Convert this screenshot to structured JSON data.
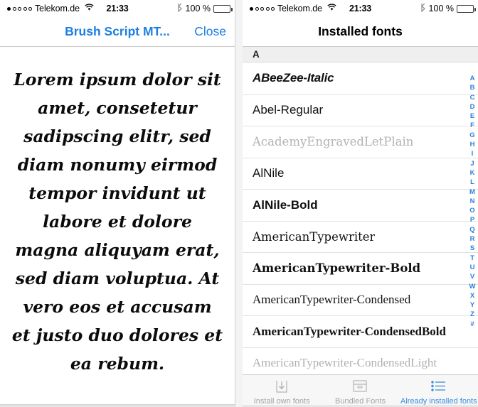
{
  "status_bar": {
    "signal_dots_total": 5,
    "signal_dots_filled": 1,
    "carrier": "Telekom.de",
    "wifi_icon": "wifi-icon",
    "time": "21:33",
    "bluetooth_icon": "bluetooth-icon",
    "battery_percent": "100 %",
    "battery_level": 100
  },
  "left_panel": {
    "navbar": {
      "title": "Brush Script MT...",
      "close_label": "Close",
      "title_color": "#1b7fe3"
    },
    "preview_text": "Lorem ipsum dolor sit amet, consetetur sadipscing elitr, sed diam nonumy eirmod tempor invidunt ut labore et dolore magna aliquyam erat, sed diam voluptua. At vero eos et accusam et justo duo dolores et ea rebum."
  },
  "right_panel": {
    "navbar": {
      "title": "Installed fonts"
    },
    "section_header": "A",
    "rows": [
      {
        "label": "ABeeZee-Italic",
        "style": "f-sans-italic"
      },
      {
        "label": "Abel-Regular",
        "style": "f-sans"
      },
      {
        "label": "AcademyEngravedLetPlain",
        "style": "f-serif-light"
      },
      {
        "label": "AlNile",
        "style": "f-sans"
      },
      {
        "label": "AlNile-Bold",
        "style": "f-sans-bold"
      },
      {
        "label": "AmericanTypewriter",
        "style": "f-mono"
      },
      {
        "label": "AmericanTypewriter-Bold",
        "style": "f-mono-bold"
      },
      {
        "label": "AmericanTypewriter-Condensed",
        "style": "f-mono-cond"
      },
      {
        "label": "AmericanTypewriter-CondensedBold",
        "style": "f-mono-cond-b"
      },
      {
        "label": "AmericanTypewriter-CondensedLight",
        "style": "f-mono-light"
      }
    ],
    "index_letters": [
      "A",
      "B",
      "C",
      "D",
      "E",
      "F",
      "G",
      "H",
      "I",
      "J",
      "K",
      "L",
      "M",
      "N",
      "O",
      "P",
      "Q",
      "R",
      "S",
      "T",
      "U",
      "V",
      "W",
      "X",
      "Y",
      "Z",
      "#"
    ],
    "index_color": "#2f7fd6",
    "tabs": [
      {
        "label": "Install own fonts",
        "icon": "download-into-box-icon",
        "active": false
      },
      {
        "label": "Bundled Fonts",
        "icon": "archive-box-icon",
        "active": false
      },
      {
        "label": "Already installed fonts",
        "icon": "bulleted-list-icon",
        "active": true
      }
    ],
    "active_tab_color": "#3d8ede",
    "inactive_tab_color": "#a4a4a4"
  }
}
